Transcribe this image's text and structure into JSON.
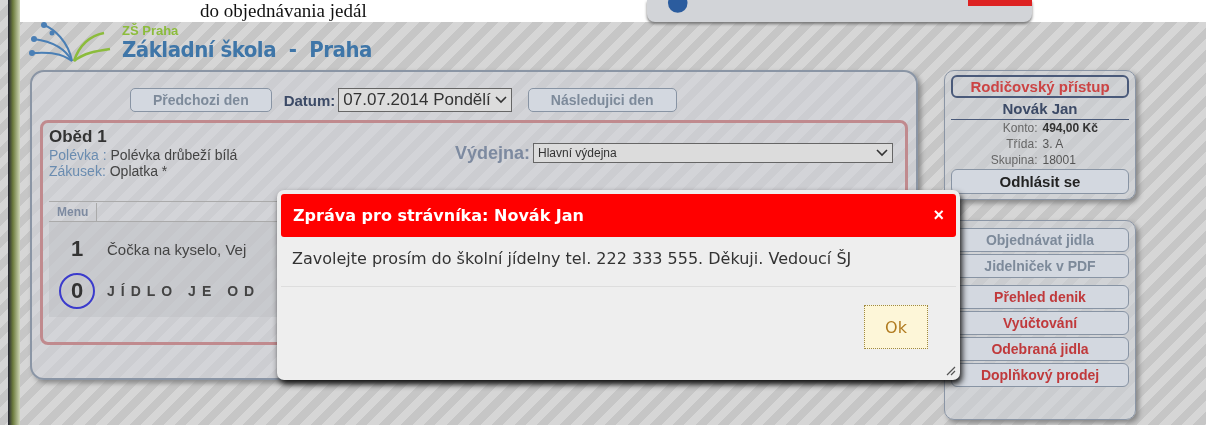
{
  "caption": "do objednávania jedál",
  "logo": {
    "title": "ZŠ Praha",
    "subtitle": "Základní škola  -  Praha"
  },
  "day_nav": {
    "prev": "Předchozi den",
    "date_label": "Datum:",
    "date": "07.07.2014 Pondělí",
    "next": "Následujici den"
  },
  "meal": {
    "title": "Oběd 1",
    "items": [
      {
        "label": "Polévka :",
        "value": "Polévka drůbeží bílá"
      },
      {
        "label": "Zákusek:",
        "value": "Oplatka *"
      }
    ],
    "outlet_label": "Výdejna:",
    "outlet": "Hlavní výdejna",
    "tab": "Menu",
    "options": [
      {
        "number": "1",
        "text": "Čočka na kyselo, Vej",
        "selected": false
      },
      {
        "number": "0",
        "text": "JÍDLO JE OD",
        "selected": true
      }
    ]
  },
  "account": {
    "title": "Rodičovský přístup",
    "name": "Novák Jan",
    "fields": [
      {
        "label": "Konto:",
        "value": "494,00 Kč",
        "emphasis": true
      },
      {
        "label": "Třída:",
        "value": "3. A",
        "emphasis": false
      },
      {
        "label": "Skupina:",
        "value": "18001",
        "emphasis": false
      }
    ],
    "logout": "Odhlásit se"
  },
  "menu": [
    {
      "label": "Objednávat jidla",
      "enabled": false
    },
    {
      "label": "Jidelniček v PDF",
      "enabled": false
    },
    {
      "label": "Přehled denik",
      "enabled": true
    },
    {
      "label": "Vyúčtování",
      "enabled": true
    },
    {
      "label": "Odebraná jidla",
      "enabled": true
    },
    {
      "label": "Doplňkový prodej",
      "enabled": true
    }
  ],
  "dialog": {
    "title": "Zpráva pro strávníka: Novák Jan",
    "close": "×",
    "message": "Zavolejte prosím do školní jídelny tel. 222 333 555. Děkuji. Vedoucí ŠJ",
    "ok": "Ok"
  }
}
